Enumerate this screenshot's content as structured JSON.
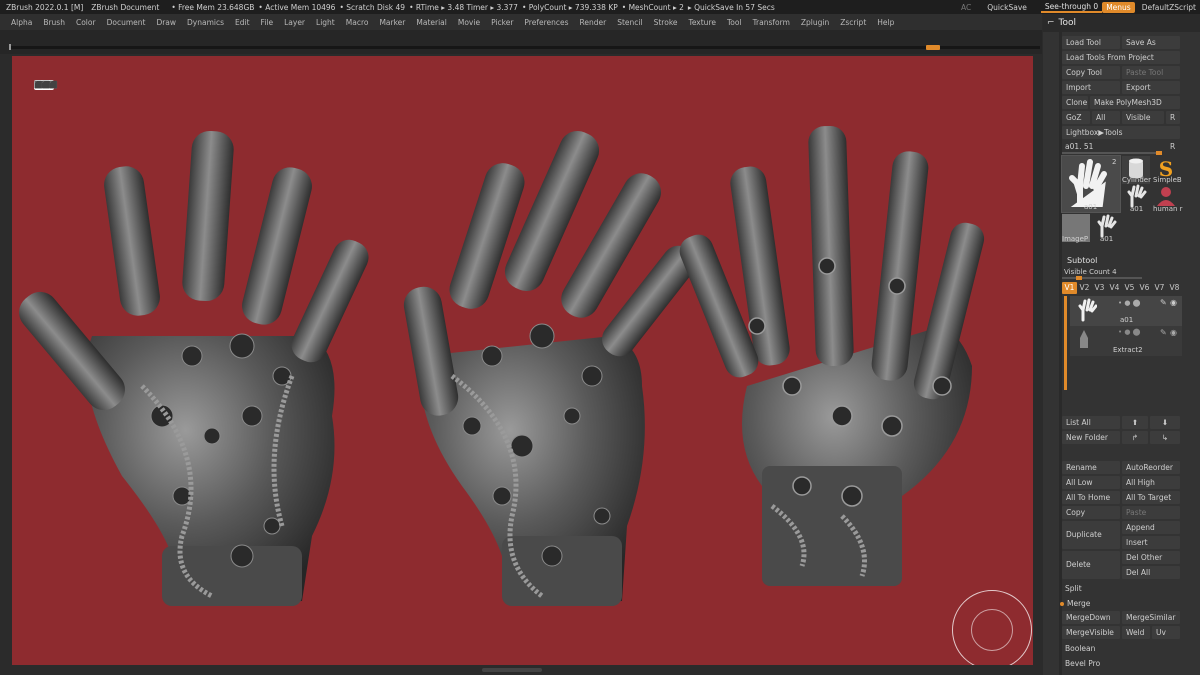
{
  "titlebar": {
    "app": "ZBrush 2022.0.1 [M]",
    "document": "ZBrush Document",
    "free_mem": "• Free Mem 23.648GB",
    "active_mem": "• Active Mem 10496",
    "scratch": "• Scratch Disk 49",
    "rtime": "• RTime ▸ 3.48 Timer ▸ 3.377",
    "polycount": "• PolyCount ▸ 739.338 KP",
    "meshcount": "• MeshCount ▸ 2",
    "quicksave_in": "▸ QuickSave In 57 Secs",
    "ac": "AC",
    "quicksave": "QuickSave",
    "see_through": "See-through  0",
    "menus": "Menus",
    "script": "DefaultZScript"
  },
  "menubar": [
    "Alpha",
    "Brush",
    "Color",
    "Document",
    "Draw",
    "Dynamics",
    "Edit",
    "File",
    "Layer",
    "Light",
    "Macro",
    "Marker",
    "Material",
    "Movie",
    "Picker",
    "Preferences",
    "Render",
    "Stencil",
    "Stroke",
    "Texture",
    "Tool",
    "Transform",
    "Zplugin",
    "Zscript",
    "Help"
  ],
  "canvas": {
    "background": "#8e2b2f",
    "badge": "⬛⬛⬛"
  },
  "tool_panel": {
    "title": "Tool",
    "load_tool": "Load Tool",
    "save_as": "Save As",
    "load_from_project": "Load Tools From Project",
    "copy_tool": "Copy Tool",
    "paste_tool": "Paste Tool",
    "import": "Import",
    "export": "Export",
    "clone": "Clone",
    "make_polymesh": "Make PolyMesh3D",
    "goz": "GoZ",
    "all": "All",
    "visible": "Visible",
    "r": "R",
    "lightbox_tools": "Lightbox▶Tools",
    "current_tool": "a01. 51",
    "r2": "R",
    "thumbs": [
      {
        "caption": "a01",
        "count": "2"
      },
      {
        "caption": "Cylinder"
      },
      {
        "caption": "SimpleB"
      },
      {
        "caption": "a01"
      },
      {
        "caption": "human r"
      },
      {
        "caption": "ImageP"
      },
      {
        "caption": "a01"
      }
    ]
  },
  "subtool": {
    "title": "Subtool",
    "visible_count": "Visible Count 4",
    "tabs": [
      "V1",
      "V2",
      "V3",
      "V4",
      "V5",
      "V6",
      "V7",
      "V8"
    ],
    "items": [
      {
        "name": "a01"
      },
      {
        "name": "Extract2"
      }
    ],
    "list_all": "List All",
    "new_folder": "New Folder",
    "rename": "Rename",
    "auto_reorder": "AutoReorder",
    "all_low": "All Low",
    "all_high": "All High",
    "all_to_home": "All To Home",
    "all_to_target": "All To Target",
    "copy": "Copy",
    "paste": "Paste",
    "duplicate": "Duplicate",
    "append": "Append",
    "insert": "Insert",
    "delete": "Delete",
    "del_other": "Del Other",
    "del_all": "Del All",
    "split": "Split",
    "merge": "Merge",
    "merge_down": "MergeDown",
    "merge_similar": "MergeSimilar",
    "merge_visible": "MergeVisible",
    "weld": "Weld",
    "uv": "Uv",
    "boolean": "Boolean",
    "bevel_pro": "Bevel Pro"
  },
  "colors": {
    "accent": "#e08a2a",
    "canvas_bg": "#8e2b2f",
    "panel_bg": "#333333"
  }
}
